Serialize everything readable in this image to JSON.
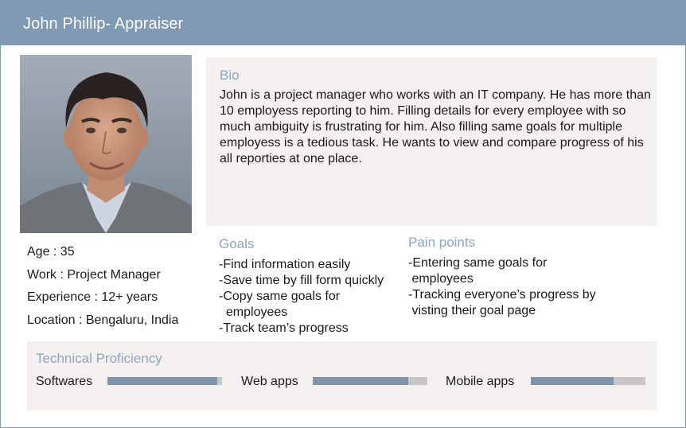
{
  "header": {
    "title": "John Phillip- Appraiser"
  },
  "profile": {
    "age": "Age : 35",
    "work": "Work : Project Manager",
    "experience": "Experience : 12+ years",
    "location": "Location : Bengaluru, India"
  },
  "bio": {
    "title": "Bio",
    "text": "John is a project manager who works with an IT company. He has more than 10 employess reporting to him. Filling details for every employee with so much ambiguity is frustrating for him. Also filling same goals for multiple employess is a tedious task. He wants to view and compare progress of his all reporties at one place."
  },
  "goals": {
    "title": "Goals",
    "items": [
      "-Find information easily",
      "-Save time by fill form quickly",
      "-Copy same goals for",
      "  employees",
      "-Track team’s progress"
    ]
  },
  "pain_points": {
    "title": "Pain points",
    "items": [
      "-Entering same goals for",
      " employees",
      "-Tracking everyone’s progress by",
      " visting their goal page"
    ]
  },
  "technical": {
    "title": "Technical Proficiency",
    "skills": [
      {
        "label": "Softwares",
        "level": 0.96
      },
      {
        "label": "Web apps",
        "level": 0.83
      },
      {
        "label": "Mobile apps",
        "level": 0.72
      }
    ]
  },
  "colors": {
    "header_bg": "#7f9ab2",
    "section_bg": "#f3f0ef",
    "bar_fill": "#7e94ab",
    "bar_track": "#c9c7c6",
    "section_title": "#8fa6bd"
  }
}
